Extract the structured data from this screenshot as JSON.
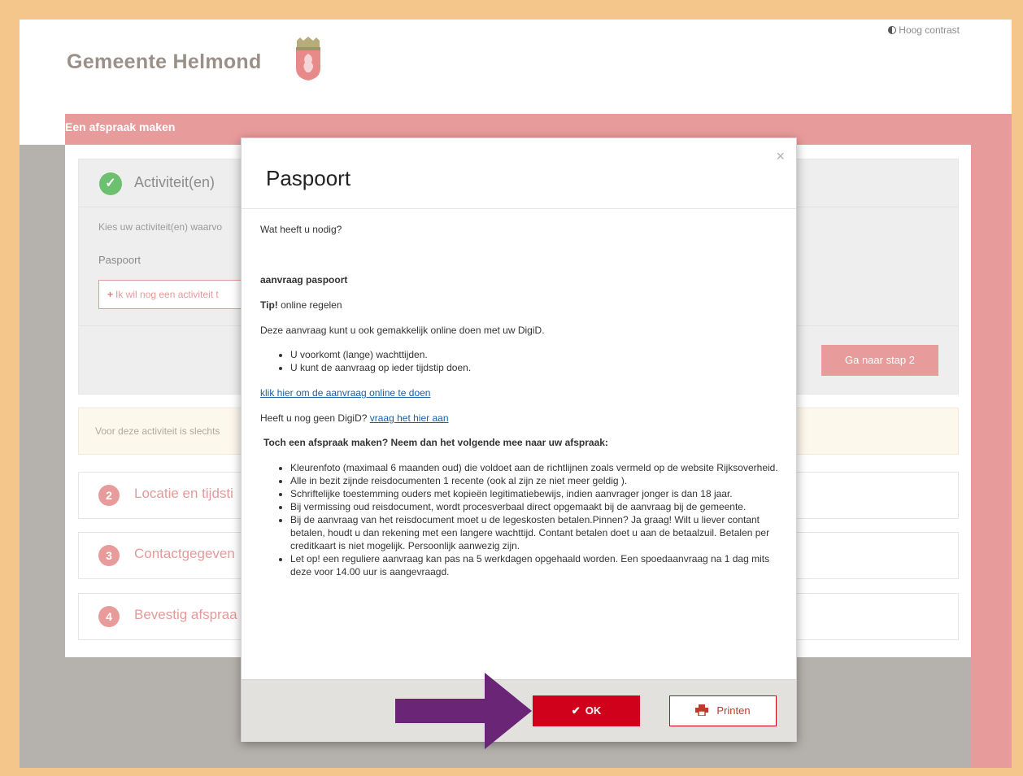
{
  "header": {
    "brand": "Gemeente Helmond",
    "contrast_label": "Hoog contrast"
  },
  "band": {
    "title": "Een afspraak maken"
  },
  "step1": {
    "title": "Activiteit(en)",
    "description": "Kies uw activiteit(en) waarvo",
    "selected_item": "Paspoort",
    "add_button": "Ik wil nog een activiteit t",
    "next_button": "Ga naar stap 2"
  },
  "notice": "Voor deze activiteit is slechts",
  "steps": [
    {
      "num": "2",
      "label": "Locatie en tijdsti"
    },
    {
      "num": "3",
      "label": "Contactgegeven"
    },
    {
      "num": "4",
      "label": "Bevestig afspraa"
    }
  ],
  "modal": {
    "title": "Paspoort",
    "close": "×",
    "question": "Wat heeft u nodig?",
    "section_title": "aanvraag paspoort",
    "tip_bold": "Tip!",
    "tip_text": " online regelen",
    "online_text": "Deze aanvraag kunt u ook gemakkelijk online doen met uw DigiD.",
    "online_bullets": [
      "U voorkomt (lange) wachttijden.",
      "U kunt de aanvraag op ieder tijdstip doen."
    ],
    "online_link": "klik hier om de aanvraag online te doen",
    "digid_text": "Heeft u nog geen DigiD? ",
    "digid_link": "vraag het hier aan",
    "bring_title": "Toch een afspraak maken? Neem dan het volgende mee naar uw afspraak:",
    "bring_bullets": [
      "Kleurenfoto (maximaal 6 maanden oud) die voldoet aan de richtlijnen zoals vermeld op de website Rijksoverheid.",
      "Alle in bezit zijnde reisdocumenten 1 recente (ook al zijn ze niet meer geldig ).",
      "Schriftelijke toestemming ouders met kopieën legitimatiebewijs, indien aanvrager jonger is dan 18 jaar.",
      "Bij vermissing oud reisdocument, wordt procesverbaal direct opgemaakt bij de aanvraag bij de gemeente.",
      "Bij de aanvraag van het reisdocument moet u de legeskosten betalen.Pinnen? Ja graag! Wilt u liever contant betalen, houdt u dan rekening met een langere wachttijd. Contant betalen doet u aan de betaalzuil. Betalen per creditkaart is niet mogelijk. Persoonlijk aanwezig zijn.",
      "Let op! een reguliere aanvraag kan pas na 5 werkdagen opgehaald worden. Een spoedaanvraag na 1 dag mits deze voor 14.00 uur is aangevraagd."
    ],
    "ok_button": "OK",
    "print_button": "Printen"
  },
  "colors": {
    "accent": "#d0021b",
    "pink": "#e89b9b",
    "frame": "#f5c68c",
    "arrow": "#6a2576"
  }
}
